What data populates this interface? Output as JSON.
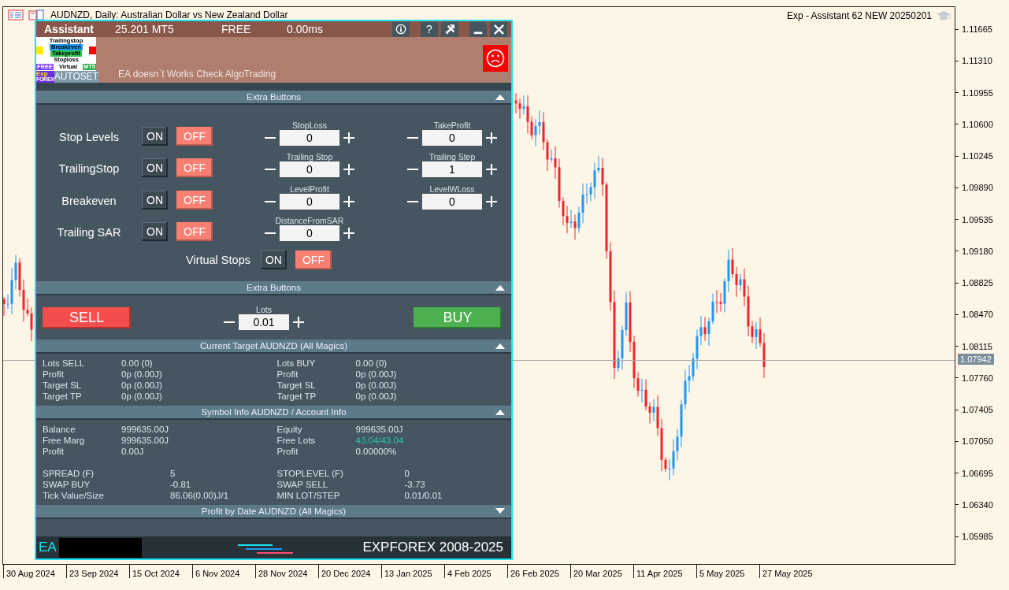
{
  "chart": {
    "title": "AUDNZD, Daily:  Australian Dollar vs New Zealand Dollar",
    "expert": "Exp - Assistant 62 NEW 20250201",
    "price_labels": [
      "1.11665",
      "1.11310",
      "1.10955",
      "1.10600",
      "1.10245",
      "1.09890",
      "1.09535",
      "1.09180",
      "1.08825",
      "1.08470",
      "1.08115",
      "1.07760",
      "1.07405",
      "1.07050",
      "1.06695",
      "1.06340",
      "1.05985"
    ],
    "current_price": "1.07942",
    "date_labels": [
      "30 Aug 2024",
      "23 Sep 2024",
      "15 Oct 2024",
      "6 Nov 2024",
      "28 Nov 2024",
      "20 Dec 2024",
      "13 Jan 2025",
      "4 Feb 2025",
      "26 Feb 2025",
      "20 Mar 2025",
      "11 Apr 2025",
      "5 May 2025",
      "27 May 2025"
    ]
  },
  "panel": {
    "header": {
      "title": "Assistant",
      "version": "25.201 MT5",
      "license": "FREE",
      "latency": "0.00ms",
      "buttons": [
        {
          "kind": "info"
        },
        {
          "kind": "help",
          "label": "?"
        },
        {
          "kind": "tools"
        },
        {
          "kind": "minimize"
        },
        {
          "kind": "close"
        }
      ]
    },
    "logo": {
      "lines": [
        "Trailingstop",
        "Breakeven",
        "Takeprofit",
        "Stoploss"
      ],
      "tags": [
        "FREE",
        "Virtual",
        "MT5"
      ],
      "mark": [
        "Exp",
        "FOREX"
      ],
      "autoset": "AUTOSET"
    },
    "status": {
      "message": "EA doesn`t Works Check AlgoTrading",
      "ok": false
    },
    "sections": [
      {
        "kind": "stops",
        "title": "Extra Buttons",
        "expanded": true,
        "rows": [
          {
            "label": "Stop Levels",
            "on_label": "ON",
            "off_label": "OFF",
            "on": false,
            "fields": [
              {
                "label": "StopLoss",
                "value": "0"
              },
              {
                "label": "TakeProfit",
                "value": "0"
              }
            ]
          },
          {
            "label": "TrailingStop",
            "on_label": "ON",
            "off_label": "OFF",
            "on": false,
            "fields": [
              {
                "label": "Trailing Stop",
                "value": "0"
              },
              {
                "label": "Trailing Step",
                "value": "1"
              }
            ]
          },
          {
            "label": "Breakeven",
            "on_label": "ON",
            "off_label": "OFF",
            "on": false,
            "fields": [
              {
                "label": "LevelProfit",
                "value": "0"
              },
              {
                "label": "LevelWLoss",
                "value": "0"
              }
            ]
          },
          {
            "label": "Trailing SAR",
            "on_label": "ON",
            "off_label": "OFF",
            "on": false,
            "fields": [
              {
                "label": "DistanceFromSAR",
                "value": "0"
              }
            ]
          }
        ],
        "virtual": {
          "label": "Virtual Stops",
          "on_label": "ON",
          "off_label": "OFF",
          "on": false
        }
      },
      {
        "kind": "trade",
        "title": "Extra Buttons",
        "expanded": true,
        "sell": "SELL",
        "buy": "BUY",
        "lots": {
          "label": "Lots",
          "value": "0.01"
        }
      },
      {
        "kind": "stats",
        "title": "Current Target AUDNZD (All Magics)",
        "expanded": true,
        "blocks": [
          {
            "left": [
              {
                "label": "Lots SELL",
                "value": "0.00 (0)",
                "highlight": false
              },
              {
                "label": "Profit",
                "value": "0p (0.00J)",
                "highlight": false
              },
              {
                "label": "Target SL",
                "value": "0p (0.00J)",
                "highlight": false
              },
              {
                "label": "Target TP",
                "value": "0p (0.00J)",
                "highlight": false
              }
            ],
            "right": [
              {
                "label": "Lots BUY",
                "value": "0.00 (0)",
                "highlight": false
              },
              {
                "label": "Profit",
                "value": "0p (0.00J)",
                "highlight": false
              },
              {
                "label": "Target SL",
                "value": "0p (0.00J)",
                "highlight": false
              },
              {
                "label": "Target TP",
                "value": "0p (0.00J)",
                "highlight": false
              }
            ]
          }
        ]
      },
      {
        "kind": "stats",
        "title": "Symbol Info AUDNZD / Account Info",
        "expanded": true,
        "blocks": [
          {
            "left": [
              {
                "label": "Balance",
                "value": "999635.00J",
                "highlight": false
              },
              {
                "label": "Free Marg",
                "value": "999635.00J",
                "highlight": false
              },
              {
                "label": "Profit",
                "value": "0.00J",
                "highlight": false
              }
            ],
            "right": [
              {
                "label": "Equity",
                "value": "999635.00J",
                "highlight": false
              },
              {
                "label": "Free Lots",
                "value": "43.04/43.04",
                "highlight": true
              },
              {
                "label": "Profit",
                "value": "0.00000%",
                "highlight": false
              }
            ]
          },
          {
            "left": [
              {
                "label": "SPREAD (F)",
                "value": "5",
                "highlight": false
              },
              {
                "label": "SWAP BUY",
                "value": "-0.81",
                "highlight": false
              },
              {
                "label": "Tick Value/Size",
                "value": "86.06(0.00)J/1",
                "highlight": false
              }
            ],
            "right": [
              {
                "label": "STOPLEVEL (F)",
                "value": "0",
                "highlight": false
              },
              {
                "label": "SWAP SELL",
                "value": "-3.73",
                "highlight": false
              },
              {
                "label": "MIN LOT/STEP",
                "value": "0.01/0.01",
                "highlight": false
              }
            ]
          }
        ]
      },
      {
        "kind": "stats",
        "title": "Profit by Date AUDNZD (All Magics)",
        "expanded": false
      }
    ],
    "footer": {
      "prefix": "EA",
      "brand": "EXPFOREX 2008-2025"
    }
  }
}
